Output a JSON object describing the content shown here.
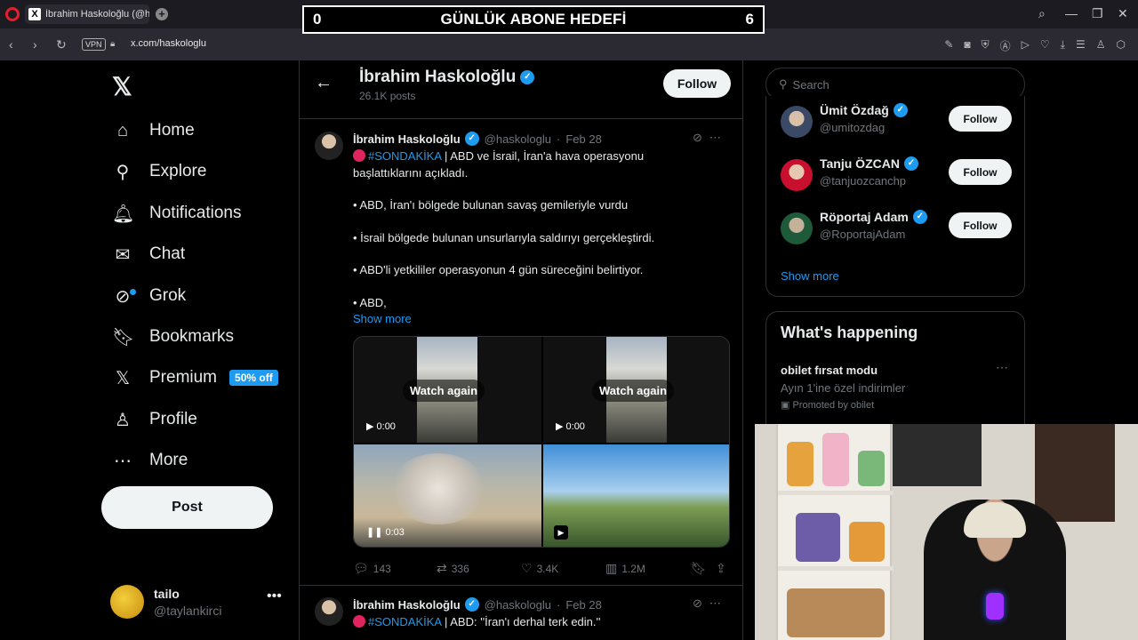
{
  "browser": {
    "tab_title": "İbrahim Haskoloğlu (@ha",
    "tab_favicon": "X",
    "vpn": "VPN",
    "url": "x.com/haskologlu"
  },
  "stream_overlay": {
    "goal_left": "0",
    "goal_title": "GÜNLÜK ABONE HEDEFİ",
    "goal_right": "6"
  },
  "nav": {
    "items": [
      {
        "label": "Home",
        "icon": "home-icon"
      },
      {
        "label": "Explore",
        "icon": "search-icon"
      },
      {
        "label": "Notifications",
        "icon": "bell-icon"
      },
      {
        "label": "Chat",
        "icon": "mail-icon"
      },
      {
        "label": "Grok",
        "icon": "grok-icon"
      },
      {
        "label": "Bookmarks",
        "icon": "bookmark-icon"
      },
      {
        "label": "Premium",
        "icon": "x-icon"
      },
      {
        "label": "Profile",
        "icon": "person-icon"
      },
      {
        "label": "More",
        "icon": "more-circle-icon"
      }
    ],
    "premium_badge": "50% off",
    "post_button": "Post",
    "account": {
      "name": "tailo",
      "handle": "@taylankirci"
    }
  },
  "profile_header": {
    "name": "İbrahim Haskoloğlu",
    "posts": "26.1K posts",
    "follow": "Follow"
  },
  "tweet1": {
    "name": "İbrahim Haskoloğlu",
    "handle": "@haskologlu",
    "date": "Feb 28",
    "hashtag": "#SONDAKİKA",
    "line1_rest": " | ABD ve İsrail, İran'a hava operasyonu başlattıklarını açıkladı.",
    "bullet1": "• ABD, İran'ı bölgede bulunan savaş gemileriyle vurdu",
    "bullet2": "• İsrail bölgede bulunan unsurlarıyla saldırıyı gerçekleştirdi.",
    "bullet3": "• ABD'li yetkililer operasyonun 4 gün süreceğini belirtiyor.",
    "bullet4": "• ABD,",
    "show_more": "Show more",
    "media": {
      "watch_again": "Watch again",
      "time_a": "0:00",
      "time_b": "0:00",
      "time_c": "0:03"
    },
    "stats": {
      "replies": "143",
      "reposts": "336",
      "likes": "3.4K",
      "views": "1.2M"
    }
  },
  "tweet2": {
    "name": "İbrahim Haskoloğlu",
    "handle": "@haskologlu",
    "date": "Feb 28",
    "hashtag": "#SONDAKİKA",
    "text": " | ABD: ''İran'ı derhal terk edin.''"
  },
  "sidebar": {
    "search_placeholder": "Search",
    "who_to_follow": [
      {
        "name": "Ümit Özdağ",
        "handle": "@umitozdag",
        "follow": "Follow"
      },
      {
        "name": "Tanju ÖZCAN",
        "handle": "@tanjuozcanchp",
        "follow": "Follow"
      },
      {
        "name": "Röportaj Adam",
        "handle": "@RoportajAdam",
        "follow": "Follow"
      }
    ],
    "show_more": "Show more",
    "happening": {
      "title": "What's happening",
      "trend_name": "obilet fırsat modu",
      "trend_desc": "Ayın 1'ine özel indirimler",
      "promoted": "Promoted by obilet"
    }
  },
  "colors": {
    "accent": "#1d9bf0",
    "background": "#000000",
    "live_dot": "#e0245e"
  }
}
